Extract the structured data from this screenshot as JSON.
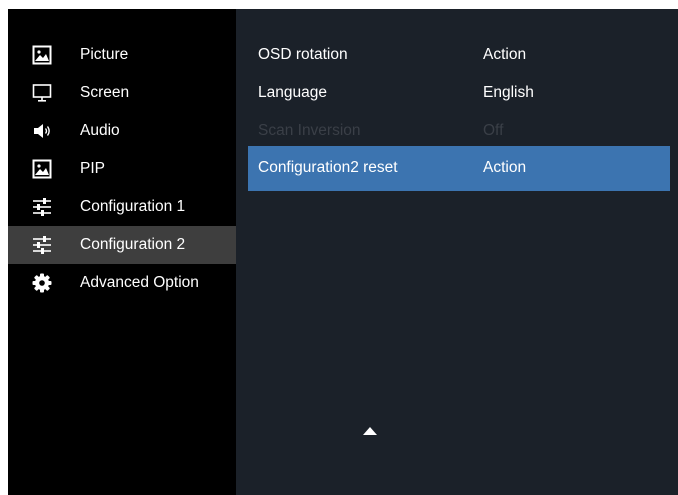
{
  "colors": {
    "sidebar_bg": "#000000",
    "panel_bg": "#1b2129",
    "active_item_bg": "#3e3e3e",
    "highlight_bg": "#3c74b0",
    "text": "#ffffff",
    "disabled_text": "#3a3f47"
  },
  "sidebar": {
    "items": [
      {
        "label": "Picture",
        "icon": "picture-icon"
      },
      {
        "label": "Screen",
        "icon": "monitor-icon"
      },
      {
        "label": "Audio",
        "icon": "speaker-icon"
      },
      {
        "label": "PIP",
        "icon": "picture-icon"
      },
      {
        "label": "Configuration 1",
        "icon": "sliders-icon"
      },
      {
        "label": "Configuration 2",
        "icon": "sliders-icon",
        "selected": true
      },
      {
        "label": "Advanced Option",
        "icon": "gear-icon"
      }
    ]
  },
  "settings": {
    "rows": [
      {
        "name": "OSD rotation",
        "value": "Action"
      },
      {
        "name": "Language",
        "value": "English"
      },
      {
        "name": "Scan Inversion",
        "value": "Off",
        "disabled": true
      },
      {
        "name": "Configuration2 reset",
        "value": "Action",
        "highlighted": true
      }
    ]
  },
  "scroll": {
    "icon": "triangle-up-icon"
  }
}
